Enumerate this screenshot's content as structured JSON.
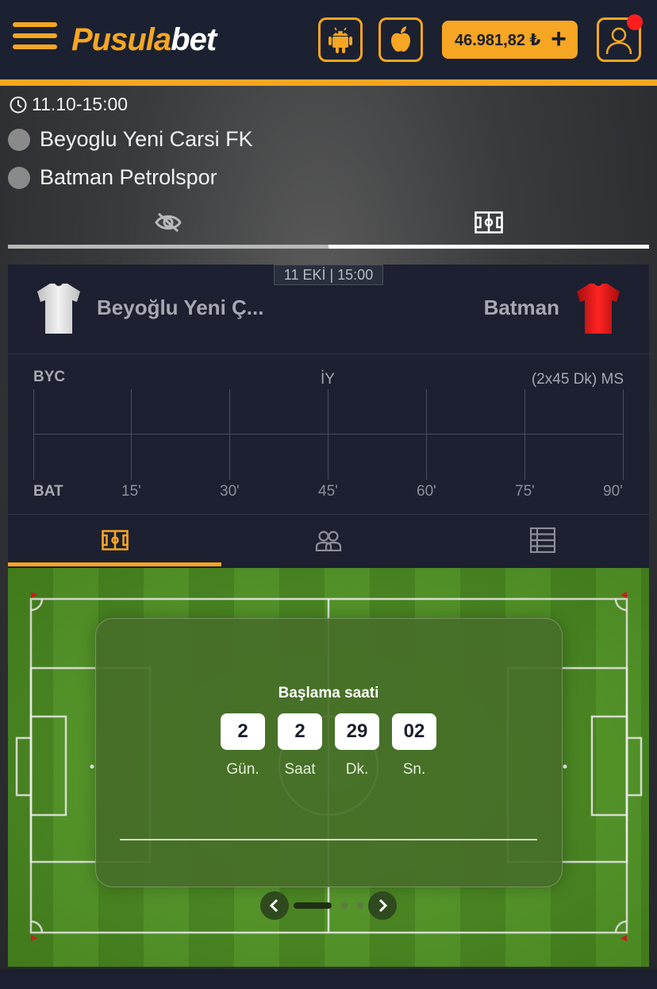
{
  "header": {
    "logo_part1": "Pusula",
    "logo_part2": "bet",
    "balance": "46.981,82 ₺",
    "balance_plus": "+"
  },
  "match": {
    "datetime": "11.10-15:00",
    "home_full": "Beyoglu Yeni Carsi FK",
    "away_full": "Batman Petrolspor"
  },
  "scoreboard": {
    "date_badge": "11 EKİ | 15:00",
    "home_short": "Beyoğlu Yeni Ç...",
    "away_short": "Batman",
    "home_code": "BYC",
    "away_code": "BAT",
    "half_label": "İY",
    "full_label": "(2x45 Dk) MS",
    "ticks": [
      "15'",
      "30'",
      "45'",
      "60'",
      "75'",
      "90'"
    ]
  },
  "countdown": {
    "title": "Başlama saati",
    "days": "2",
    "hours": "2",
    "minutes": "29",
    "seconds": "02",
    "days_label": "Gün.",
    "hours_label": "Saat",
    "minutes_label": "Dk.",
    "seconds_label": "Sn."
  },
  "colors": {
    "accent": "#f6a623",
    "header_bg": "#1b2131",
    "panel_bg": "#1c2030",
    "pitch_green": "#4a8a1f",
    "notification": "#ff1e1e",
    "away_jersey": "#e01515",
    "home_jersey": "#e6e6e6"
  },
  "icons": {
    "menu": "hamburger-icon",
    "android": "android-icon",
    "apple": "apple-icon",
    "user": "user-icon",
    "clock": "clock-icon",
    "hide": "eye-off-icon",
    "pitch": "pitch-icon",
    "lineups": "users-icon",
    "standings": "table-icon"
  }
}
